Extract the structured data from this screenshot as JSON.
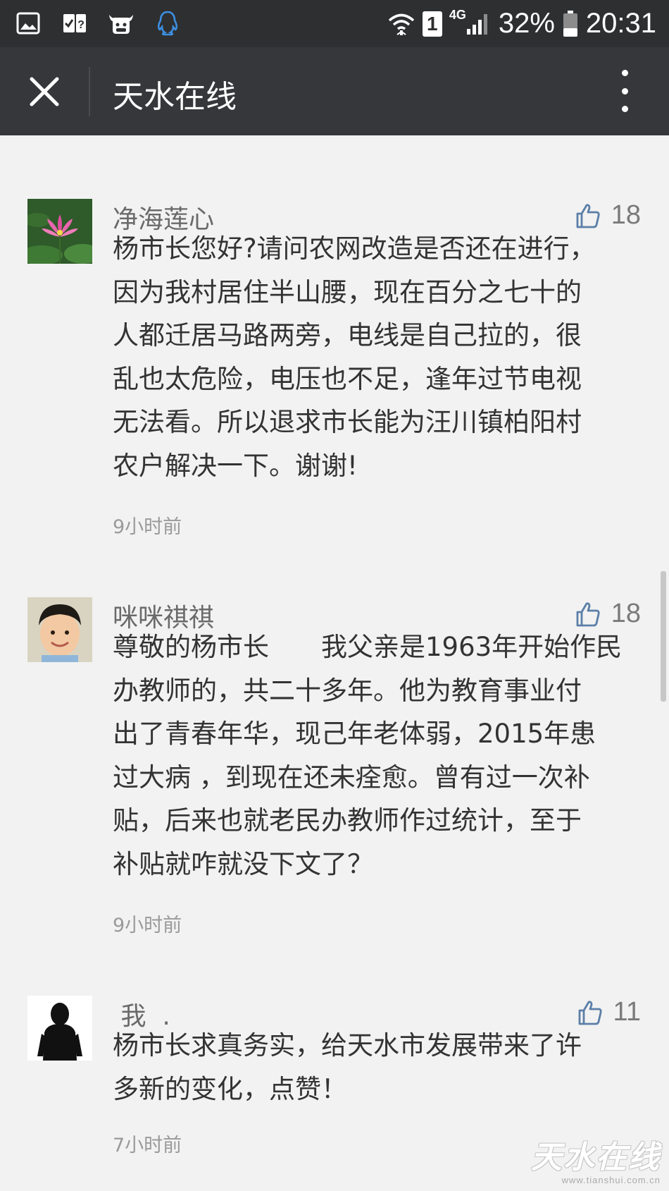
{
  "status_bar": {
    "network": "4G",
    "sim": "1",
    "battery": "32%",
    "time": "20:31"
  },
  "app_bar": {
    "title": "天水在线"
  },
  "comments": [
    {
      "nickname": "净海莲心",
      "likes": "18",
      "lines": [
        "杨市长您好?请问农网改造是否还在进行，",
        "因为我村居住半山腰，现在百分之七十的",
        "人都迁居马路两旁，电线是自己拉的，很",
        "乱也太危险，电压也不足，逢年过节电视",
        "无法看。所以退求市长能为汪川镇柏阳村",
        "农户解决一下。谢谢!"
      ],
      "time": "9小时前"
    },
    {
      "nickname": "咪咪祺祺",
      "likes": "18",
      "lines": [
        "尊敬的杨市长　　我父亲是1963年开始作民",
        "办教师的，共二十多年。他为教育事业付",
        "出了青春年华，现己年老体弱，2015年患",
        "过大病 ，到现在还未痊愈。曾有过一次补",
        "贴，后来也就老民办教师作过统计，至于",
        "补贴就咋就没下文了？"
      ],
      "time": "9小时前"
    },
    {
      "nickname": " 我  .",
      "likes": "11",
      "lines": [
        "杨市长求真务实，给天水市发展带来了许",
        "多新的变化，点赞！"
      ],
      "time": "7小时前"
    }
  ],
  "watermark": {
    "text": "天水在线",
    "url": "www.tianshui.com.cn"
  },
  "colors": {
    "status_bar": "#2e2f31",
    "app_bar": "#36373b",
    "background": "#f2f2f2",
    "like_icon": "#5b7fa8"
  }
}
